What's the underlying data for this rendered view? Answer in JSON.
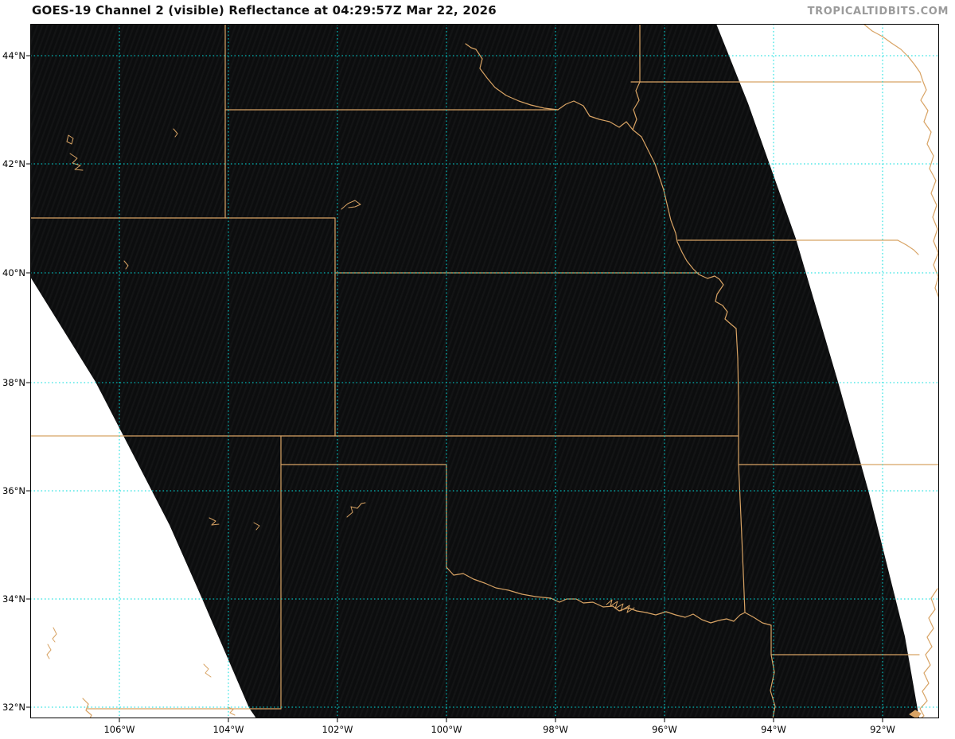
{
  "header": {
    "title": "GOES-19 Channel 2 (visible) Reflectance at 04:29:57Z Mar 22, 2026",
    "watermark": "TROPICALTIDBITS.COM"
  },
  "colors": {
    "bg": "#ffffff",
    "swath": "#0c0d0e",
    "grid": "#00dcdc",
    "orange": "#d8a364",
    "watermark": "#9b9b9b"
  },
  "axes": {
    "latitude_labels": [
      {
        "label": "44°N"
      },
      {
        "label": "42°N"
      },
      {
        "label": "40°N"
      },
      {
        "label": "38°N"
      },
      {
        "label": "36°N"
      },
      {
        "label": "34°N"
      },
      {
        "label": "32°N"
      }
    ],
    "longitude_labels": [
      {
        "label": "106°W"
      },
      {
        "label": "104°W"
      },
      {
        "label": "102°W"
      },
      {
        "label": "100°W"
      },
      {
        "label": "98°W"
      },
      {
        "label": "96°W"
      },
      {
        "label": "94°W"
      },
      {
        "label": "92°W"
      }
    ]
  }
}
